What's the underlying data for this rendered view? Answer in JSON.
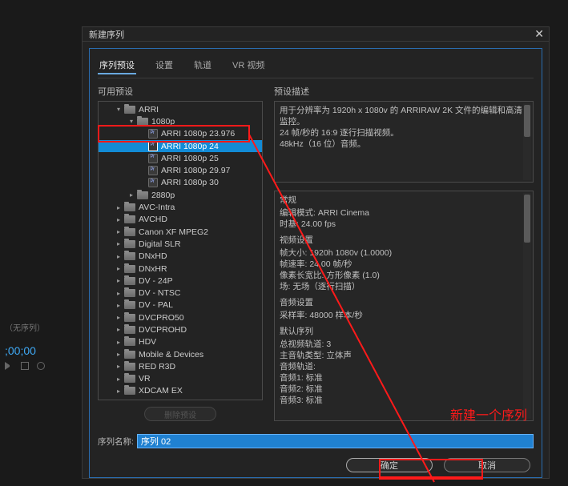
{
  "bg": {
    "no_sequence": "（无序列）",
    "timecode": ";00;00",
    "equals": "="
  },
  "dialog": {
    "title": "新建序列"
  },
  "tabs": [
    "序列预设",
    "设置",
    "轨道",
    "VR 视频"
  ],
  "labels": {
    "available_presets": "可用预设",
    "preset_description": "预设描述",
    "delete_preset": "删除预设",
    "sequence_name": "序列名称:"
  },
  "tree": {
    "arri": "ARRI",
    "p1080": "1080p",
    "presets_1080": [
      "ARRI 1080p 23.976",
      "ARRI 1080p 24",
      "ARRI 1080p 25",
      "ARRI 1080p 29.97",
      "ARRI 1080p 30"
    ],
    "p2880": "2880p",
    "folders": [
      "AVC-Intra",
      "AVCHD",
      "Canon XF MPEG2",
      "Digital SLR",
      "DNxHD",
      "DNxHR",
      "DV - 24P",
      "DV - NTSC",
      "DV - PAL",
      "DVCPRO50",
      "DVCPROHD",
      "HDV",
      "Mobile & Devices",
      "RED R3D",
      "VR",
      "XDCAM EX"
    ]
  },
  "description": {
    "line1": "用于分辨率为 1920h x 1080v 的 ARRIRAW 2K 文件的编辑和高清监控。",
    "line2": "24 帧/秒的 16:9 逐行扫描视频。",
    "line3": "48kHz（16 位）音频。"
  },
  "details": {
    "general_h": "常规",
    "edit_mode": "编辑模式: ARRI Cinema",
    "timebase": "时基: 24.00 fps",
    "video_h": "视频设置",
    "frame_size": "帧大小: 1920h 1080v (1.0000)",
    "frame_rate": "帧速率: 24.00 帧/秒",
    "par": "像素长宽比: 方形像素 (1.0)",
    "fields": "场: 无场（逐行扫描）",
    "audio_h": "音频设置",
    "sample_rate": "采样率: 48000 样本/秒",
    "default_seq_h": "默认序列",
    "total_video": "总视频轨道: 3",
    "master_type": "主音轨类型: 立体声",
    "audio_tracks": "音频轨道:",
    "audio1": "音频1: 标准",
    "audio2": "音频2: 标准",
    "audio3": "音频3: 标准"
  },
  "sequence_name_value": "序列 02",
  "buttons": {
    "ok": "确定",
    "cancel": "取消"
  },
  "annotation": "新建一个序列"
}
